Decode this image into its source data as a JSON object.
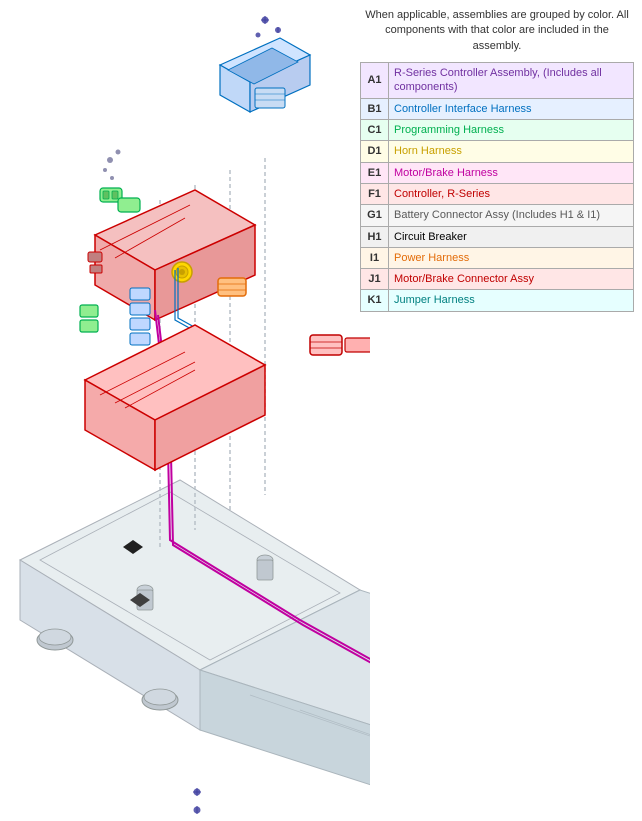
{
  "legend": {
    "intro": "When applicable, assemblies are grouped by color. All components with that color are included in the assembly.",
    "rows": [
      {
        "code": "A1",
        "desc": "R-Series Controller Assembly, (Includes all components)",
        "colorClass": "color-purple",
        "rowBg": "row-purple-bg"
      },
      {
        "code": "B1",
        "desc": "Controller Interface Harness",
        "colorClass": "color-blue",
        "rowBg": "row-blue-bg"
      },
      {
        "code": "C1",
        "desc": "Programming Harness",
        "colorClass": "color-green",
        "rowBg": "row-green-bg"
      },
      {
        "code": "D1",
        "desc": "Horn Harness",
        "colorClass": "color-yellow",
        "rowBg": "row-yellow-bg"
      },
      {
        "code": "E1",
        "desc": "Motor/Brake Harness",
        "colorClass": "color-magenta",
        "rowBg": "row-magenta-bg"
      },
      {
        "code": "F1",
        "desc": "Controller, R-Series",
        "colorClass": "color-red",
        "rowBg": "row-red-bg"
      },
      {
        "code": "G1",
        "desc": "Battery Connector Assy (Includes H1 & I1)",
        "colorClass": "color-gray",
        "rowBg": "row-gray-bg"
      },
      {
        "code": "H1",
        "desc": "Circuit Breaker",
        "colorClass": "color-black",
        "rowBg": "row-black-bg"
      },
      {
        "code": "I1",
        "desc": "Power Harness",
        "colorClass": "color-orange",
        "rowBg": "row-orange-bg"
      },
      {
        "code": "J1",
        "desc": "Motor/Brake Connector Assy",
        "colorClass": "color-darkred",
        "rowBg": "row-darkred-bg"
      },
      {
        "code": "K1",
        "desc": "Jumper Harness",
        "colorClass": "color-teal",
        "rowBg": "row-teal-bg"
      }
    ]
  }
}
